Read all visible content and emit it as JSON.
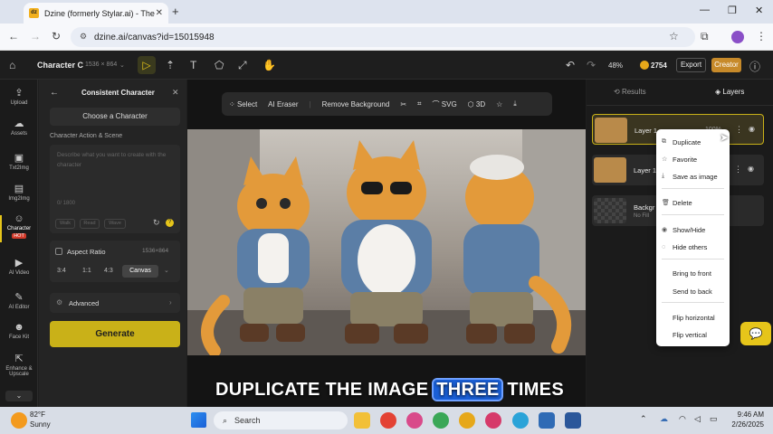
{
  "browser": {
    "tab_title": "Dzine (formerly Stylar.ai) - The",
    "url": "dzine.ai/canvas?id=15015948",
    "favicon_text": "dz"
  },
  "app": {
    "project_name": "Character C",
    "canvas_size": "1536 × 864",
    "zoom": "48%",
    "credits": "2754",
    "export_label": "Export",
    "creator_label": "Creator"
  },
  "leftnav": [
    {
      "label": "Upload",
      "icon": "upload-icon"
    },
    {
      "label": "Assets",
      "icon": "assets-icon"
    },
    {
      "label": "Txt2Img",
      "icon": "txt2img-icon"
    },
    {
      "label": "Img2Img",
      "icon": "img2img-icon"
    },
    {
      "label": "Character",
      "icon": "character-icon",
      "badge": "HOT"
    },
    {
      "label": "AI Video",
      "icon": "video-icon"
    },
    {
      "label": "AI Editor",
      "icon": "editor-icon"
    },
    {
      "label": "Face Kit",
      "icon": "facekit-icon"
    },
    {
      "label": "Enhance & Upscale",
      "icon": "enhance-icon"
    }
  ],
  "panel": {
    "title": "Consistent Character",
    "choose_label": "Choose a Character",
    "section_label": "Character Action & Scene",
    "textarea_placeholder": "Describe what you want to create with the character",
    "char_count": "0/ 1800",
    "chips": [
      "Walk",
      "Read",
      "Wave"
    ],
    "aspect_label": "Aspect Ratio",
    "aspect_value": "1536×864",
    "ratios": [
      "3:4",
      "1:1",
      "4:3",
      "Canvas"
    ],
    "advanced_label": "Advanced",
    "generate_label": "Generate"
  },
  "canvas_toolbar": {
    "select": "Select",
    "eraser": "AI Eraser",
    "remove_bg": "Remove Background",
    "svg": "SVG",
    "three_d": "3D"
  },
  "right_panel": {
    "results_label": "Results",
    "layers_label": "Layers",
    "layers": [
      {
        "name": "Layer 1",
        "extra": "100%"
      },
      {
        "name": "Layer 1",
        "extra": ""
      },
      {
        "name": "Backgr",
        "sub": "No Fill"
      }
    ]
  },
  "context_menu": [
    "Duplicate",
    "Favorite",
    "Save as image",
    "Delete",
    "Show/Hide",
    "Hide others",
    "Bring to front",
    "Send to back",
    "Flip horizontal",
    "Flip vertical"
  ],
  "caption": {
    "before": "DUPLICATE THE IMAGE ",
    "highlight": "THREE",
    "after": " TIMES"
  },
  "taskbar": {
    "weather_temp": "82°F",
    "weather_desc": "Sunny",
    "search_placeholder": "Search",
    "time": "9:46 AM",
    "date": "2/26/2025"
  },
  "colors": {
    "accent": "#e6c51a",
    "generate_bg": "#c9b118",
    "highlight": "#1a5fd6"
  }
}
